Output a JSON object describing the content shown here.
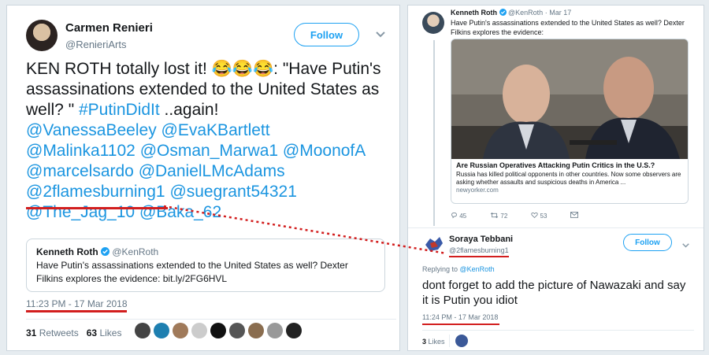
{
  "left_tweet": {
    "author_name": "Carmen Renieri",
    "author_handle": "@RenieriArts",
    "follow_label": "Follow",
    "text_plain_1": "KEN ROTH totally lost it! ",
    "emoji": "😂😂😂",
    "text_plain_2": ": \"Have Putin's assassinations extended to the United States as well? \" ",
    "hashtag": "#PutinDidIt",
    "text_plain_3": " ..again!",
    "mentions": [
      "@VanessaBeeley",
      "@EvaKBartlett",
      "@Malinka1102",
      "@Osman_Marwa1",
      "@MoonofA",
      "@marcelsardo",
      "@DanielLMcAdams",
      "@2flamesburning1",
      "@suegrant54321",
      "@The_Jag_10",
      "@Baka_62"
    ],
    "quote": {
      "author_name": "Kenneth Roth",
      "author_handle": "@KenRoth",
      "text": "Have Putin's assassinations extended to the United States as well? Dexter Filkins explores the evidence: bit.ly/2FG6HVL"
    },
    "timestamp": "11:23 PM - 17 Mar 2018",
    "retweets_count": "31",
    "retweets_label": "Retweets",
    "likes_count": "63",
    "likes_label": "Likes"
  },
  "right_thread": {
    "original": {
      "author_name": "Kenneth Roth",
      "author_handle": "@KenRoth",
      "date": "Mar 17",
      "text": "Have Putin's assassinations extended to the United States as well? Dexter Filkins explores the evidence:",
      "card_title": "Are Russian Operatives Attacking Putin Critics in the U.S.?",
      "card_desc": "Russia has killed political opponents in other countries. Now some observers are asking whether assaults and suspicious deaths in America ...",
      "card_source": "newyorker.com",
      "replies": "45",
      "retweets": "72",
      "likes": "53"
    },
    "reply": {
      "author_name": "Soraya Tebbani",
      "author_handle": "@2flamesburning1",
      "follow_label": "Follow",
      "replying_prefix": "Replying to ",
      "replying_to": "@KenRoth",
      "text": "dont forget to add the picture of Nawazaki and say it is Putin you idiot",
      "timestamp": "11:24 PM - 17 Mar 2018",
      "likes_count": "3",
      "likes_label": "Likes"
    }
  },
  "colors": {
    "link": "#1b95e0",
    "annotation_red": "#d21e1e",
    "follow_blue": "#1da1f2"
  },
  "icons": [
    "verified-badge-icon",
    "chevron-down-icon",
    "reply-icon",
    "retweet-icon",
    "like-icon",
    "dm-icon"
  ]
}
